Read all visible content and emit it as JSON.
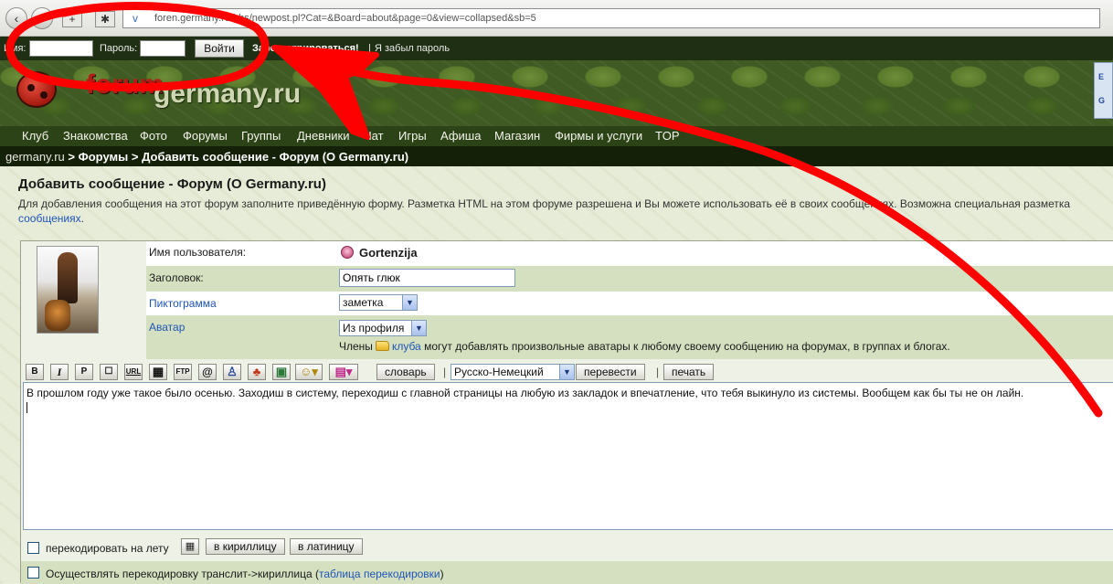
{
  "browser": {
    "url": "foren.germany.ru/bbs/newpost.pl?Cat=&Board=about&page=0&view=collapsed&sb=5",
    "url_icon": "v",
    "back_glyph": "‹",
    "forward_glyph": "›",
    "tool1_glyph": "+",
    "tool2_glyph": "✱"
  },
  "login": {
    "name_label": "Имя:",
    "password_label": "Пароль:",
    "submit_label": "Войти",
    "register_label": "Зарегистрироваться!",
    "forgot_label": "Я забыл пароль"
  },
  "logo": {
    "part1": "forum",
    "part2": "germany.ru"
  },
  "side_widget": {
    "line1": "E",
    "line2": "G"
  },
  "nav": {
    "items": [
      "Клуб",
      "Знакомства",
      "Фото",
      "Форумы",
      "Группы",
      "Дневники",
      "Чат",
      "Игры",
      "Афиша",
      "Магазин",
      "Фирмы и услуги",
      "TOP"
    ]
  },
  "breadcrumb": {
    "home": "germany.ru",
    "sep": ">",
    "forums": "Форумы",
    "current": "Добавить сообщение - Форум (О Germany.ru)"
  },
  "page": {
    "title": "Добавить сообщение - Форум (О Germany.ru)",
    "desc_line1": "Для добавления сообщения на этот форум заполните приведённую форму. Разметка HTML на этом форуме разрешена и Вы можете использовать её в своих сообщениях. Возможна специальная разметка",
    "desc_link": "сообщениях",
    "desc_end": "."
  },
  "form": {
    "username_label": "Имя пользователя:",
    "username_value": "Gortenzija",
    "subject_label": "Заголовок:",
    "subject_value": "Опять глюк",
    "icon_label": "Пиктограмма",
    "icon_value": "заметка",
    "avatar_label": "Аватар",
    "avatar_value": "Из профиля",
    "avatar_note_before": "Члены",
    "avatar_note_link": "клуба",
    "avatar_note_after": "могут добавлять произвольные аватары к любому своему сообщению на форумах, в группах и блогах."
  },
  "toolbar": {
    "bold": "B",
    "italic": "I",
    "para": "P",
    "quote": "☐",
    "url": "URL",
    "video": "▦",
    "ftp": "FTP",
    "email": "@",
    "user": "♙",
    "group": "♣",
    "image": "▣",
    "smile": "☺",
    "color": "▤",
    "dictionary": "словарь",
    "sep": "|",
    "lang_value": "Русско-Немецкий",
    "translate": "перевести",
    "print": "печать"
  },
  "message": {
    "text": "В прошлом году уже такое было осенью. Заходиш в систему, переходиш с главной страницы на любую из закладок и впечатление, что тебя выкинуло из системы. Вообщем как бы ты не он лайн."
  },
  "options": {
    "recode_label": "перекодировать на лету",
    "keyboard_glyph": "▦",
    "cyrillic_btn": "в кириллицу",
    "latin_btn": "в латиницу",
    "translit_before": "Осуществлять перекодировку транслит->кириллица (",
    "translit_link": "таблица перекодировки",
    "translit_after": ")"
  },
  "colors": {
    "annotation": "#ff0000",
    "link": "#1f55b8",
    "nav_bg": "#2c4318",
    "row_green": "#d5e0c0"
  }
}
